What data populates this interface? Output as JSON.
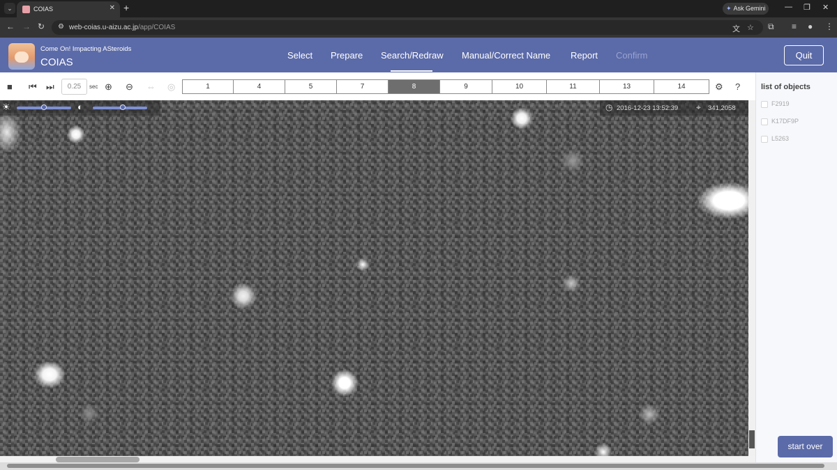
{
  "browser": {
    "tab_title": "COIAS",
    "tab_close": "✕",
    "new_tab": "+",
    "ask_gemini": "Ask Gemini",
    "url_host": "web-coias.u-aizu.ac.jp",
    "url_path": "/app/COIAS"
  },
  "header": {
    "subtitle": "Come On! Impacting ASteroids",
    "brand": "COIAS",
    "menu": [
      {
        "label": "Select"
      },
      {
        "label": "Prepare"
      },
      {
        "label": "Search/Redraw",
        "active": true
      },
      {
        "label": "Manual/Correct Name"
      },
      {
        "label": "Report"
      },
      {
        "label": "Confirm",
        "disabled": true
      }
    ],
    "quit_label": "Quit"
  },
  "toolbar": {
    "speed_value": "0.25",
    "speed_unit": "sec",
    "frames": [
      "1",
      "4",
      "5",
      "7",
      "8",
      "9",
      "10",
      "11",
      "13",
      "14"
    ],
    "active_frame": "8"
  },
  "viewer": {
    "timestamp": "2016-12-23 13:52:39",
    "coords": "341,2058",
    "brightness_level": 0.5,
    "contrast_level": 0.55
  },
  "panel": {
    "title": "list of objects",
    "objects": [
      "F2919",
      "K17DF9P",
      "L5263"
    ],
    "start_over_label": "start over"
  },
  "colors": {
    "header_bg": "#5b6aa8",
    "active_frame_bg": "#6e6e6e",
    "viewer_bg": "#555555"
  }
}
